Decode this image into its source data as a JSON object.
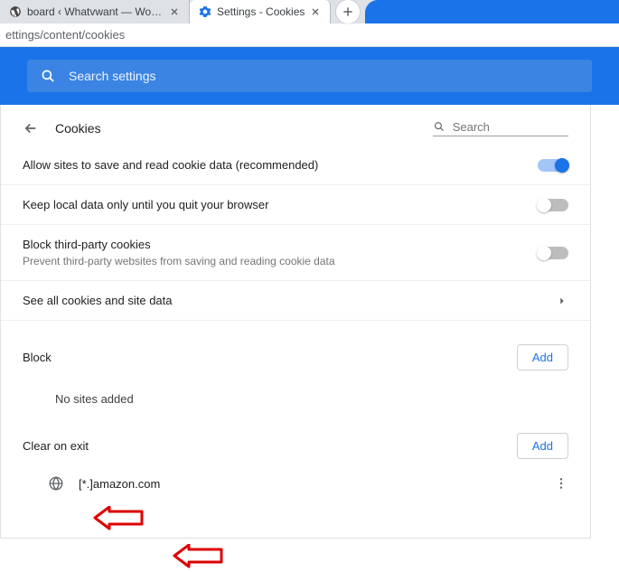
{
  "tabs": {
    "inactive_title": "board ‹ Whatvwant — Wor…",
    "active_title": "Settings - Cookies"
  },
  "address_bar": "ettings/content/cookies",
  "header_search_placeholder": "Search settings",
  "page": {
    "title": "Cookies",
    "search_placeholder": "Search"
  },
  "rows": {
    "allow": "Allow sites to save and read cookie data (recommended)",
    "keep": "Keep local data only until you quit your browser",
    "block_title": "Block third-party cookies",
    "block_sub": "Prevent third-party websites from saving and reading cookie data",
    "see_all": "See all cookies and site data"
  },
  "sections": {
    "block_label": "Block",
    "block_add": "Add",
    "block_empty": "No sites added",
    "clear_label": "Clear on exit",
    "clear_add": "Add",
    "clear_site": "[*.]amazon.com"
  },
  "toggles": {
    "allow": true,
    "keep": false,
    "block": false
  },
  "colors": {
    "accent": "#1a73e8"
  }
}
